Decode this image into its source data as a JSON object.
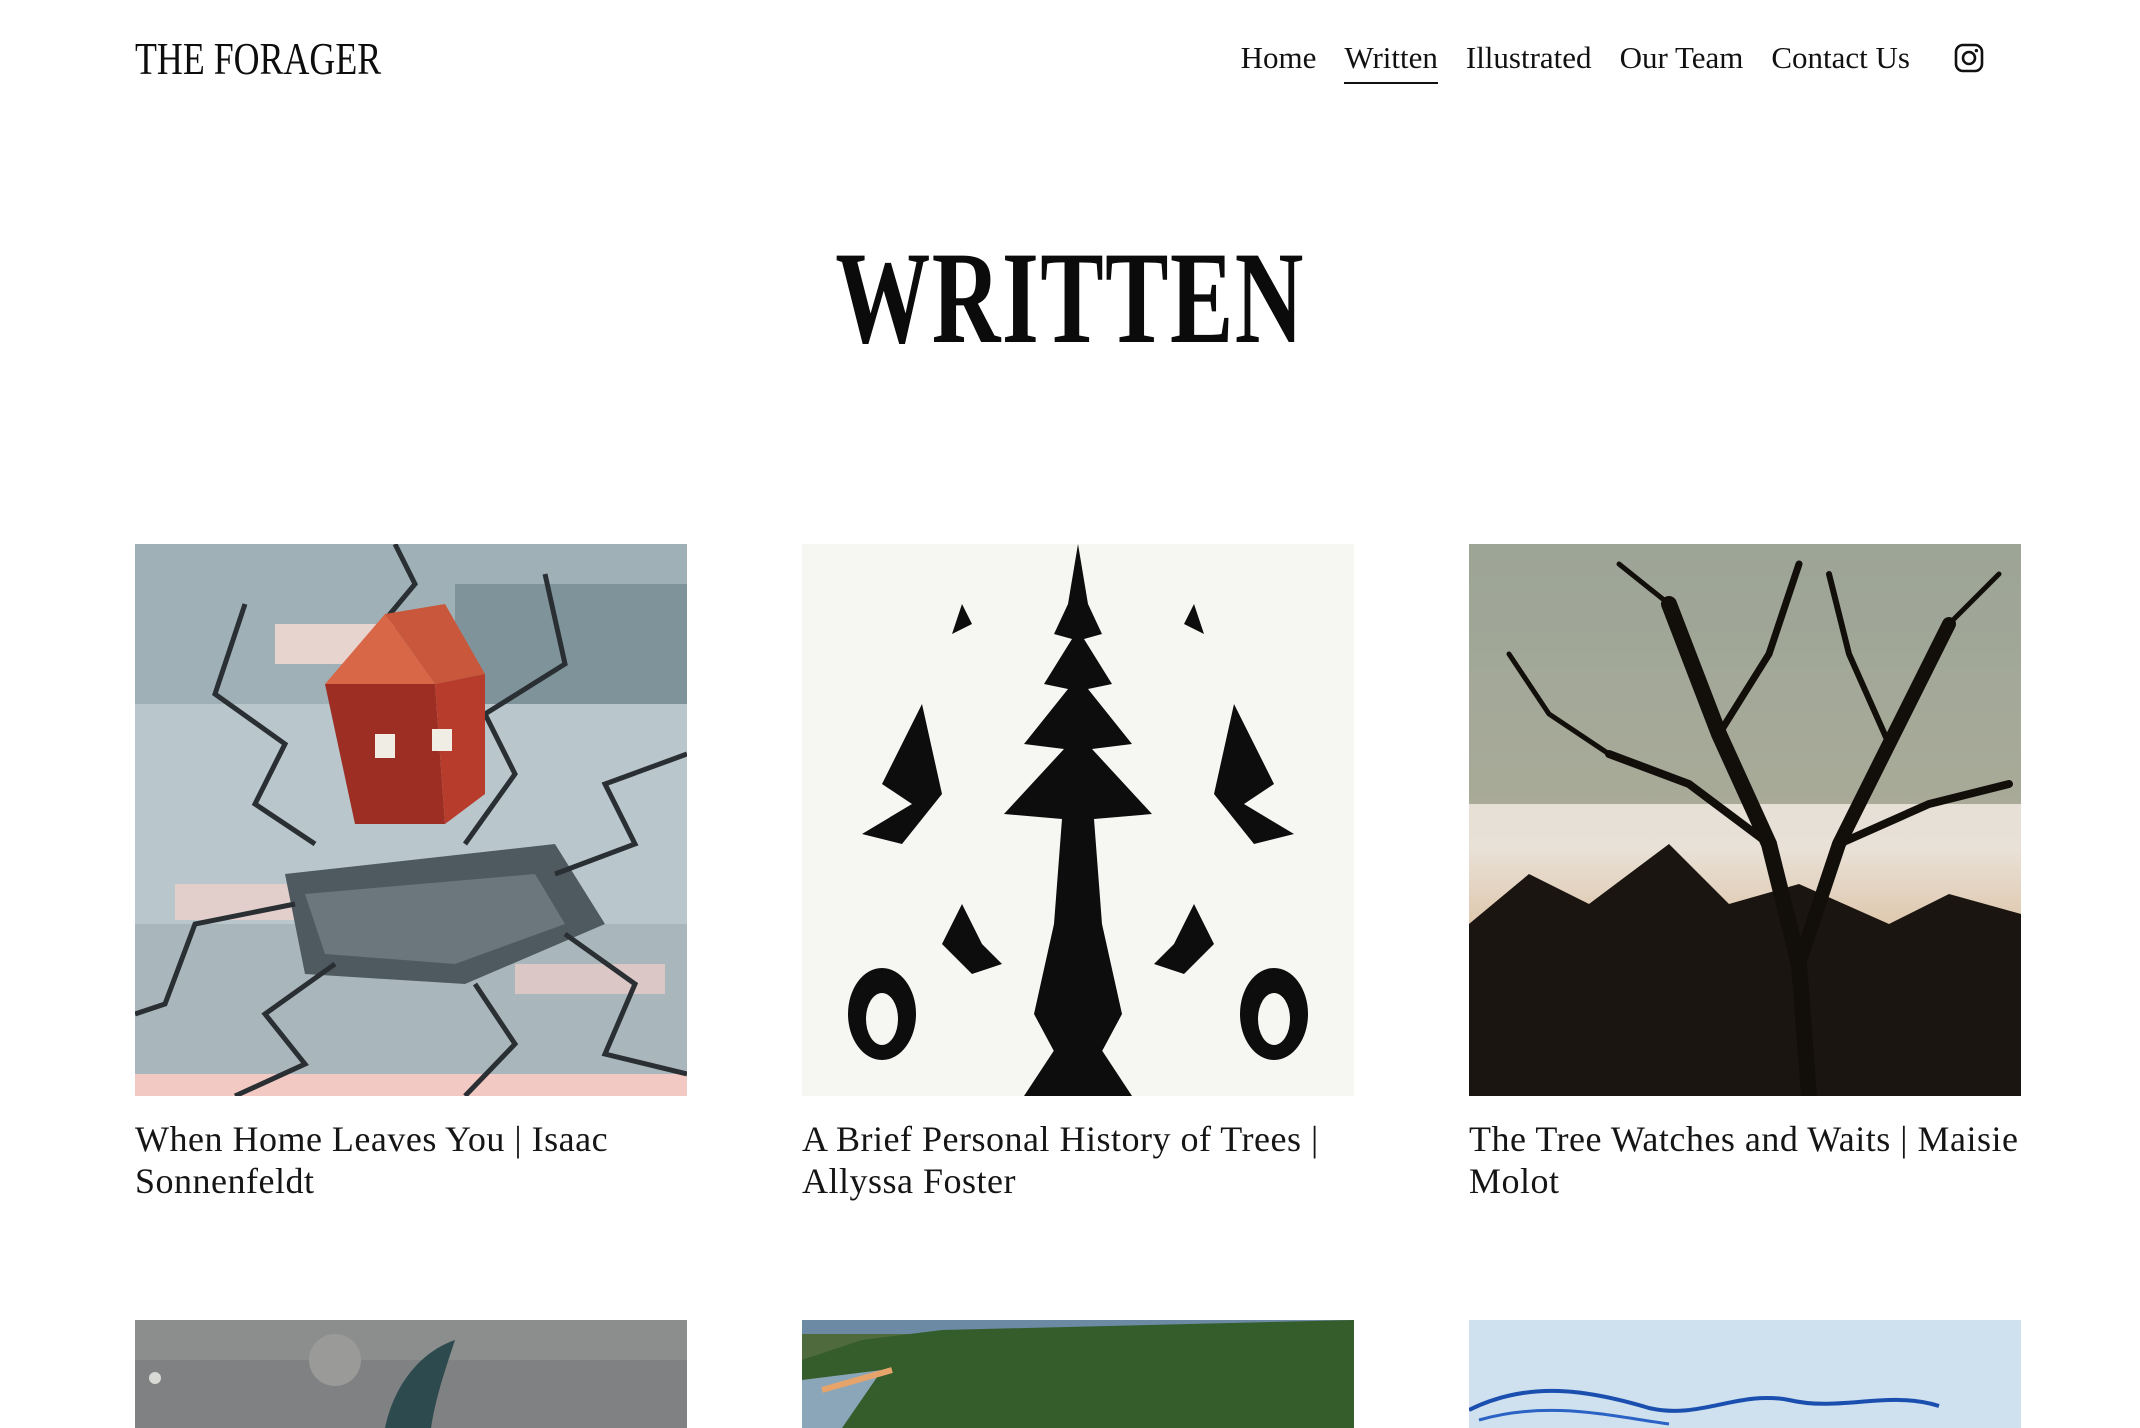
{
  "header": {
    "site_title": "THE FORAGER",
    "nav": [
      {
        "label": "Home",
        "active": false
      },
      {
        "label": "Written",
        "active": true
      },
      {
        "label": "Illustrated",
        "active": false
      },
      {
        "label": "Our Team",
        "active": false
      },
      {
        "label": "Contact Us",
        "active": false
      }
    ],
    "social_icon": "instagram-icon"
  },
  "main": {
    "heading": "WRITTEN",
    "posts": [
      {
        "title": "When Home Leaves You | Isaac Sonnenfeldt",
        "image": "painting of red house on cracked ice"
      },
      {
        "title": "A Brief Personal History of Trees | Allyssa Foster",
        "image": "black ink symmetric tree"
      },
      {
        "title": "The Tree Watches and Waits | Maisie Molot",
        "image": "silhouetted tree at dusk photo"
      }
    ],
    "partial_posts": [
      {
        "image": "gray painting with whale"
      },
      {
        "image": "green hillside and lake photo"
      },
      {
        "image": "blue line drawing on paper"
      }
    ]
  },
  "colors": {
    "background": "#ffffff",
    "text": "#111111"
  }
}
